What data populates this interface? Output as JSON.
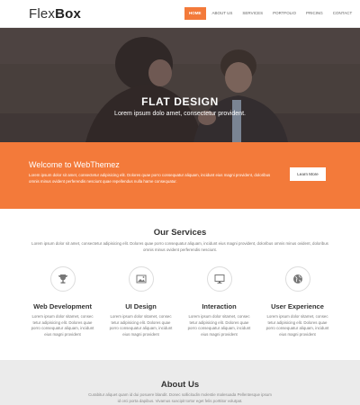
{
  "brand": {
    "name_light": "Flex",
    "name_bold": "Box"
  },
  "nav": {
    "items": [
      {
        "label": "HOME",
        "active": true
      },
      {
        "label": "ABOUT US",
        "active": false
      },
      {
        "label": "SERVICES",
        "active": false
      },
      {
        "label": "PORTFOLIO",
        "active": false
      },
      {
        "label": "PRICING",
        "active": false
      },
      {
        "label": "CONTACT",
        "active": false
      }
    ]
  },
  "hero": {
    "title": "FLAT DESIGN",
    "subtitle": "Lorem ipsum dolo amet, consectetur provident."
  },
  "welcome": {
    "title": "Welcome to WebThemez",
    "text": "Lorem ipsum dolor sit amet, consectetur adipisicing elit. Dolores quae porro consequatur aliquam, incidunt eius magni provident, doloribus omnis minus ovident perferendis nesciunt quae repellendus nulla hame consequatur.",
    "button_label": "Learn More"
  },
  "services": {
    "title": "Our Services",
    "intro": "Lorem ipsum dolor sit amet, consectetur adipisicing elit. Dolores quae porro consequatur aliquam, incidunt eius magni provident, doloribus omnis minus ovident, doloribus omnis minus ovident perferendis nesciunt.",
    "items": [
      {
        "name": "Web Development",
        "icon": "trophy-icon",
        "text": "Lorem ipsum dolor sitamet, consec tetur adipisicing elit. Dolores quae porro consequatur aliquam, incidunt eius magni provident"
      },
      {
        "name": "UI Design",
        "icon": "image-icon",
        "text": "Lorem ipsum dolor sitamet, consec tetur adipisicing elit. Dolores quae porro consequatur aliquam, incidunt eius magni provident"
      },
      {
        "name": "Interaction",
        "icon": "monitor-icon",
        "text": "Lorem ipsum dolor sitamet, consec tetur adipisicing elit. Dolores quae porro consequatur aliquam, incidunt eius magni provident"
      },
      {
        "name": "User Experience",
        "icon": "globe-icon",
        "text": "Lorem ipsum dolor sitamet, consec tetur adipisicing elit. Dolores quae porro consequatur aliquam, incidunt eius magni provident"
      }
    ]
  },
  "about": {
    "title": "About Us",
    "text": "Curabitur aliquet quam id dui posuere blandit. Donec sollicitudin molestie malesuada Pellentesque ipsum id orci porta dapibus. Vivamus suscipit tortor eget felis porttitor volutpat."
  },
  "colors": {
    "accent": "#f37a3a",
    "hero_overlay": "#4d4443",
    "about_bg": "#ebebeb"
  }
}
